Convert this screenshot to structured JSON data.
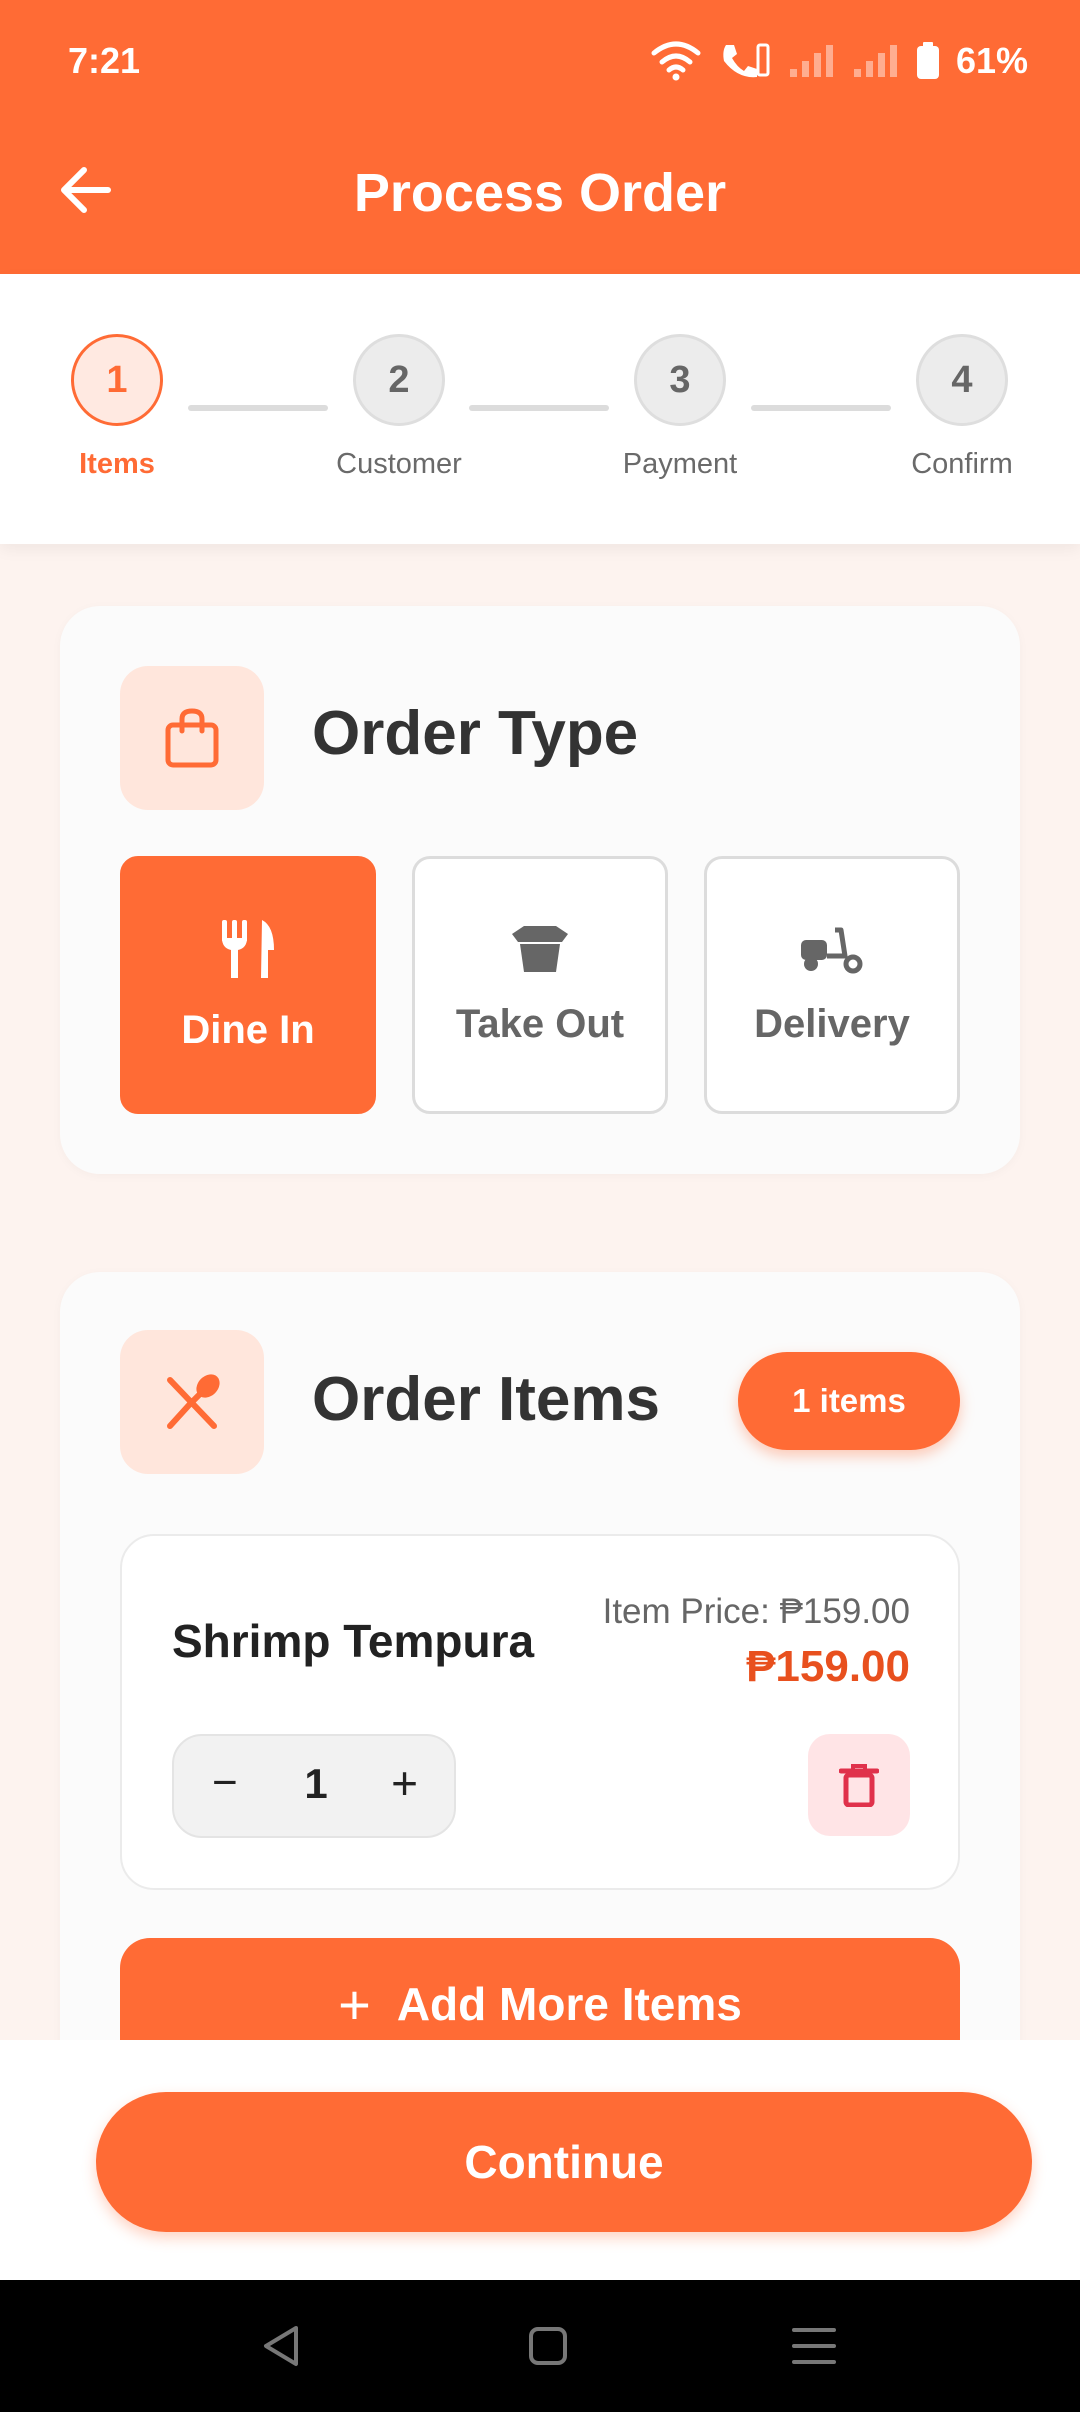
{
  "status_bar": {
    "time": "7:21",
    "battery": "61%"
  },
  "header": {
    "title": "Process Order"
  },
  "stepper": {
    "steps": [
      {
        "number": "1",
        "label": "Items"
      },
      {
        "number": "2",
        "label": "Customer"
      },
      {
        "number": "3",
        "label": "Payment"
      },
      {
        "number": "4",
        "label": "Confirm"
      }
    ]
  },
  "order_type": {
    "title": "Order Type",
    "options": [
      {
        "label": "Dine In",
        "icon": "utensils-icon",
        "selected": true
      },
      {
        "label": "Take Out",
        "icon": "takeout-box-icon",
        "selected": false
      },
      {
        "label": "Delivery",
        "icon": "scooter-icon",
        "selected": false
      }
    ]
  },
  "order_items": {
    "title": "Order Items",
    "count_badge": "1 items",
    "items": [
      {
        "name": "Shrimp Tempura",
        "unit_price": "Item Price: ₱159.00",
        "total": "₱159.00",
        "quantity": "1"
      }
    ],
    "minus": "−",
    "plus": "+",
    "add_more_plus": "+",
    "add_more_label": "Add More Items"
  },
  "footer": {
    "continue_label": "Continue"
  },
  "colors": {
    "accent": "#ff6b35",
    "price": "#e8501e",
    "delete_bg": "#ffe4e6",
    "delete_icon": "#e0314b"
  }
}
